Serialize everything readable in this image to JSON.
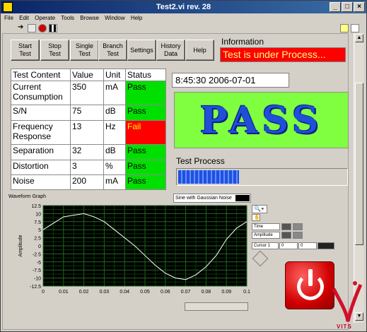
{
  "window": {
    "title": "Test2.vi rev. 28"
  },
  "menu": [
    "File",
    "Edit",
    "Operate",
    "Tools",
    "Browse",
    "Window",
    "Help"
  ],
  "buttons": [
    {
      "l1": "Start",
      "l2": "Test"
    },
    {
      "l1": "Stop",
      "l2": "Test"
    },
    {
      "l1": "Single",
      "l2": "Test"
    },
    {
      "l1": "Branch",
      "l2": "Test"
    },
    {
      "l1": "Settings",
      "l2": ""
    },
    {
      "l1": "History",
      "l2": "Data"
    },
    {
      "l1": "Help",
      "l2": ""
    }
  ],
  "information": {
    "label": "Information",
    "message": "Test is under Process..."
  },
  "table": {
    "headers": [
      "Test Content",
      "Value",
      "Unit",
      "Status"
    ],
    "rows": [
      {
        "content": "Current Consumption",
        "value": "350",
        "unit": "mA",
        "status": "Pass"
      },
      {
        "content": "S/N",
        "value": "75",
        "unit": "dB",
        "status": "Pass"
      },
      {
        "content": "Frequency Response",
        "value": "13",
        "unit": "Hz",
        "status": "Fail"
      },
      {
        "content": "Separation",
        "value": "32",
        "unit": "dB",
        "status": "Pass"
      },
      {
        "content": "Distortion",
        "value": "3",
        "unit": "%",
        "status": "Pass"
      },
      {
        "content": "Noise",
        "value": "200",
        "unit": "mA",
        "status": "Pass"
      }
    ]
  },
  "datetime": "8:45:30 2006-07-01",
  "result": "PASS",
  "test_process": {
    "label": "Test Process",
    "progress": 0.36
  },
  "graph": {
    "title": "Waveform Graph",
    "legend": "Sine with Gaussian Noise",
    "ylabel": "Amplitude",
    "yticks": [
      "12.5",
      "10",
      "7.5",
      "5",
      "2.5",
      "0",
      "-2.5",
      "-5",
      "-7.5",
      "-10",
      "-12.5"
    ],
    "xticks": [
      "0",
      "0.01",
      "0.02",
      "0.03",
      "0.04",
      "0.05",
      "0.06",
      "0.07",
      "0.08",
      "0.09",
      "0.1"
    ],
    "time_label": "Time",
    "amplitude_label": "Amplitude",
    "cursor_label": "Cursor 1",
    "cursor_x": "0",
    "cursor_y": "0"
  },
  "chart_data": {
    "type": "line",
    "xlim": [
      0,
      0.1
    ],
    "ylim": [
      -12.5,
      12.5
    ],
    "series": [
      {
        "x": [
          0,
          0.005,
          0.01,
          0.015,
          0.02,
          0.025,
          0.03,
          0.035,
          0.04,
          0.045,
          0.05,
          0.055,
          0.06,
          0.065,
          0.07,
          0.075,
          0.08,
          0.085,
          0.09,
          0.095,
          0.1
        ],
        "values": [
          5,
          7,
          9,
          9.5,
          10,
          9,
          7.5,
          5,
          2.5,
          0,
          -3,
          -6,
          -8.5,
          -10,
          -10.5,
          -9,
          -6.5,
          -3,
          2,
          5.5,
          7.5
        ]
      }
    ]
  },
  "colors": {
    "pass": "#00e000",
    "fail": "#ff0000",
    "info_bg": "#ff0000",
    "result_bg": "#80ff40",
    "result_text": "#1f4fd6"
  },
  "brand": "VITS"
}
